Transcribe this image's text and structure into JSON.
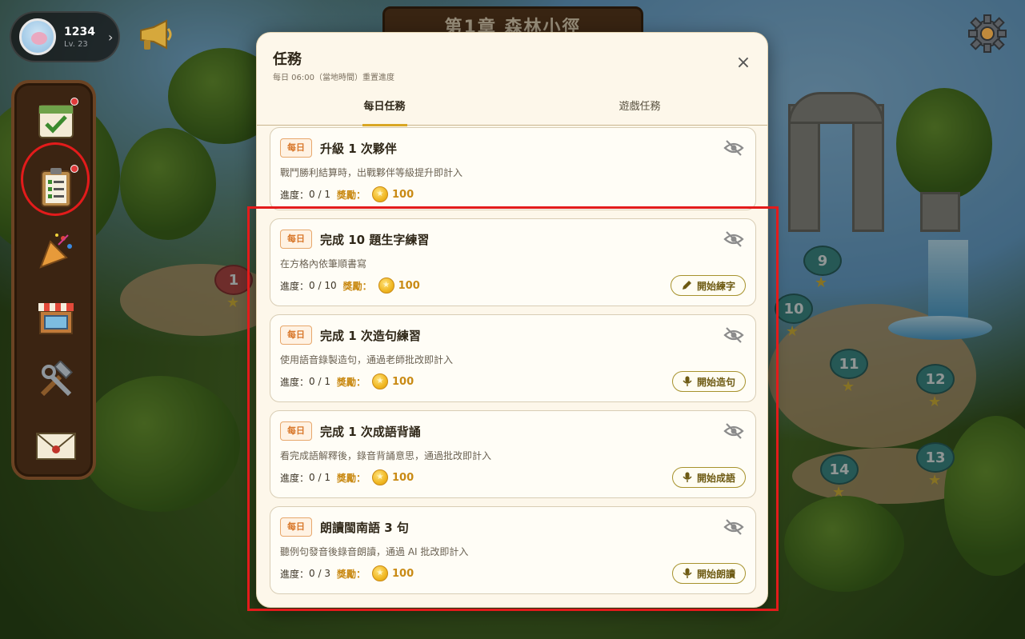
{
  "profile": {
    "score": "1234",
    "level": "Lv. 23"
  },
  "chapter": {
    "title": "第1章 森林小徑"
  },
  "map_nodes": [
    {
      "label": "1",
      "red": true
    },
    {
      "label": "9"
    },
    {
      "label": "10"
    },
    {
      "label": "11"
    },
    {
      "label": "12"
    },
    {
      "label": "13"
    },
    {
      "label": "14"
    }
  ],
  "sidebar": {
    "items": [
      {
        "name": "calendar-check-icon",
        "dot": true
      },
      {
        "name": "clipboard-tasks-icon",
        "dot": true,
        "highlighted": true
      },
      {
        "name": "party-popper-icon"
      },
      {
        "name": "shop-icon"
      },
      {
        "name": "tools-icon"
      },
      {
        "name": "mail-icon"
      }
    ]
  },
  "modal": {
    "title": "任務",
    "subtitle": "每日 06:00（當地時間）重置進度",
    "close": "×",
    "tabs": [
      {
        "label": "每日任務",
        "active": true
      },
      {
        "label": "遊戲任務",
        "active": false
      }
    ],
    "progress_label": "進度：",
    "reward_label": "獎勵：",
    "tasks": [
      {
        "badge": "每日",
        "title": "升級 1 次夥伴",
        "desc": "戰鬥勝利結算時，出戰夥伴等級提升即計入",
        "progress": "0 / 1",
        "reward": "100",
        "action": "",
        "action_icon": ""
      },
      {
        "badge": "每日",
        "title": "完成 10 題生字練習",
        "desc": "在方格內依筆順書寫",
        "progress": "0 / 10",
        "reward": "100",
        "action": "開始練字",
        "action_icon": "pencil-icon"
      },
      {
        "badge": "每日",
        "title": "完成 1 次造句練習",
        "desc": "使用語音錄製造句，通過老師批改即計入",
        "progress": "0 / 1",
        "reward": "100",
        "action": "開始造句",
        "action_icon": "microphone-icon"
      },
      {
        "badge": "每日",
        "title": "完成 1 次成語背誦",
        "desc": "看完成語解釋後，錄音背誦意思，通過批改即計入",
        "progress": "0 / 1",
        "reward": "100",
        "action": "開始成語",
        "action_icon": "microphone-icon"
      },
      {
        "badge": "每日",
        "title": "朗讀閩南語 3 句",
        "desc": "聽例句發音後錄音朗讀，通過 AI 批改即計入",
        "progress": "0 / 3",
        "reward": "100",
        "action": "開始朗讀",
        "action_icon": "microphone-icon"
      }
    ]
  },
  "colors": {
    "accent_gold": "#d9a623",
    "badge_orange": "#d8772a",
    "annotation_red": "#e31b1b",
    "modal_bg": "#fdf7ea"
  }
}
